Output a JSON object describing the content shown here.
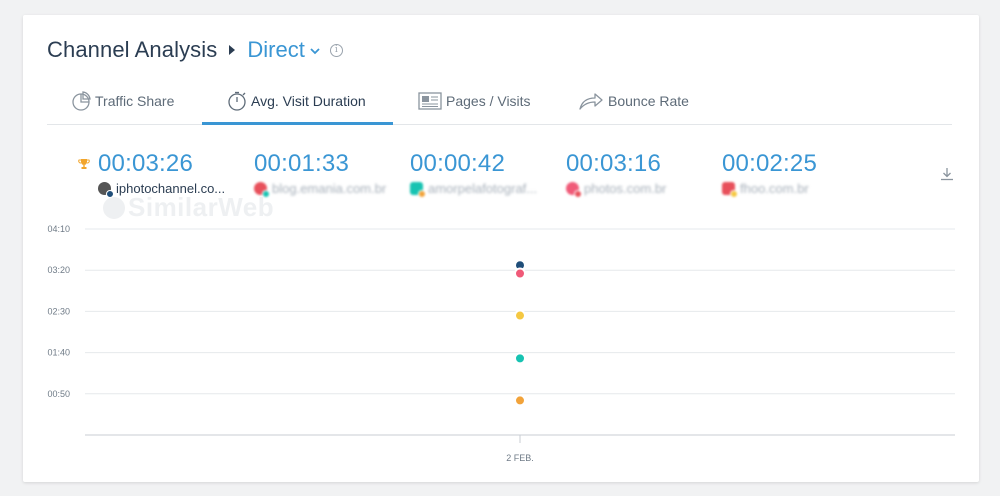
{
  "header": {
    "title": "Channel Analysis",
    "channel": "Direct"
  },
  "tabs": [
    {
      "label": "Traffic Share",
      "icon": "pie-chart-icon",
      "active": false
    },
    {
      "label": "Avg. Visit Duration",
      "icon": "stopwatch-icon",
      "active": true
    },
    {
      "label": "Pages / Visits",
      "icon": "pages-icon",
      "active": false
    },
    {
      "label": "Bounce Rate",
      "icon": "bounce-arrow-icon",
      "active": false
    }
  ],
  "metrics": [
    {
      "value": "00:03:26",
      "site": "iphotochannel.co...",
      "color": "#1f4e79",
      "blurred": false,
      "leader": true
    },
    {
      "value": "00:01:33",
      "site": "blog.emania.com.br",
      "color": "#e8505b",
      "blurred": true,
      "leader": false
    },
    {
      "value": "00:00:42",
      "site": "amorpelafotograf...",
      "color": "#17c3b2",
      "blurred": true,
      "leader": false
    },
    {
      "value": "00:03:16",
      "site": "photos.com.br",
      "color": "#f05a78",
      "blurred": true,
      "leader": false
    },
    {
      "value": "00:02:25",
      "site": "fhoo.com.br",
      "color": "#f2a33a",
      "blurred": true,
      "leader": false
    }
  ],
  "watermark": "SimilarWeb",
  "chart_data": {
    "type": "scatter",
    "x": [
      "2 FEB."
    ],
    "y_ticks": [
      "00:50",
      "01:40",
      "02:30",
      "03:20",
      "04:10"
    ],
    "y_tick_seconds": [
      50,
      100,
      150,
      200,
      250
    ],
    "ylim_seconds": [
      0,
      250
    ],
    "series": [
      {
        "name": "iphotochannel.co...",
        "color": "#1f4e79",
        "values_seconds": [
          206
        ]
      },
      {
        "name": "photos.com.br",
        "color": "#f05a78",
        "values_seconds": [
          196
        ]
      },
      {
        "color": "#f5c842",
        "values_seconds": [
          145
        ]
      },
      {
        "color": "#17c3b2",
        "values_seconds": [
          93
        ]
      },
      {
        "color": "#f2a33a",
        "values_seconds": [
          42
        ]
      }
    ],
    "grid": true
  }
}
